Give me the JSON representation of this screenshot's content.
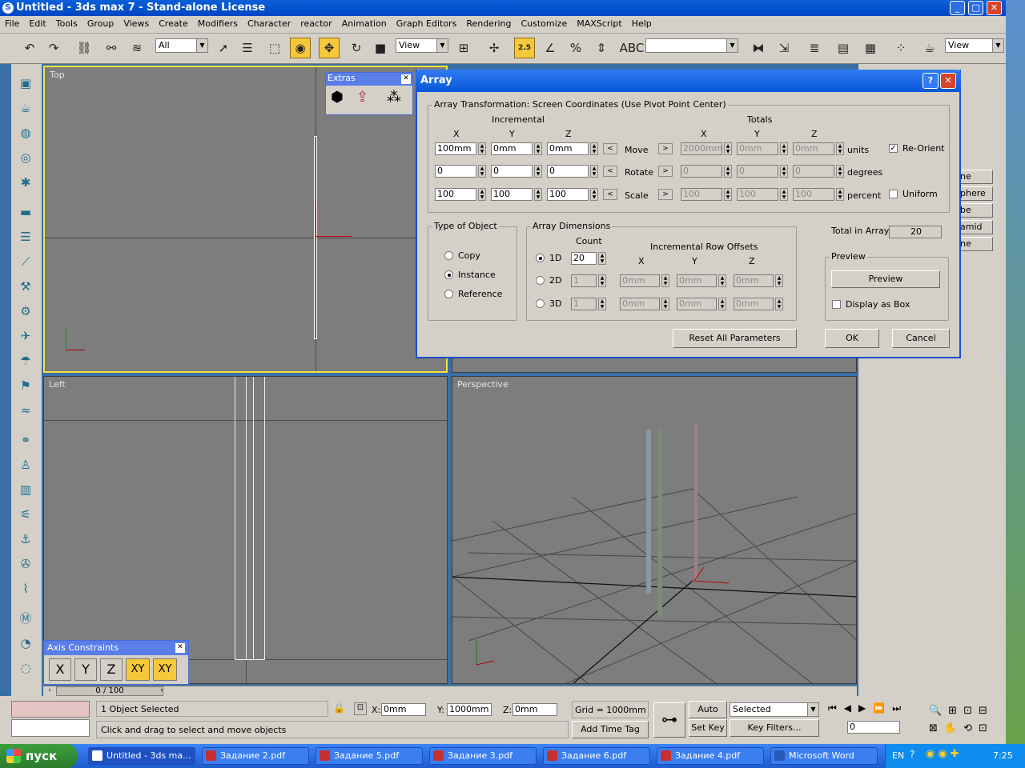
{
  "window": {
    "title": "Untitled - 3ds max 7  - Stand-alone License"
  },
  "menu": [
    "File",
    "Edit",
    "Tools",
    "Group",
    "Views",
    "Create",
    "Modifiers",
    "Character",
    "reactor",
    "Animation",
    "Graph Editors",
    "Rendering",
    "Customize",
    "MAXScript",
    "Help"
  ],
  "toolbar": {
    "filter": "All",
    "ref_coord": "View",
    "ref_coord2": "View",
    "snap_label": "2.5",
    "named_sel": ""
  },
  "viewports": {
    "top": "Top",
    "left": "Left",
    "perspective": "Perspective"
  },
  "extras": {
    "title": "Extras"
  },
  "axis": {
    "title": "Axis Constraints",
    "buttons": [
      "X",
      "Y",
      "Z",
      "XY",
      "XY"
    ]
  },
  "timeline": {
    "frame": "0 / 100"
  },
  "right_panel": {
    "items": [
      "ne",
      "phere",
      "be",
      "amid",
      "ne"
    ]
  },
  "array_dialog": {
    "title": "Array",
    "transform_group": "Array Transformation: Screen Coordinates (Use Pivot Point Center)",
    "incremental": "Incremental",
    "totals": "Totals",
    "x": "X",
    "y": "Y",
    "z": "Z",
    "rows": [
      {
        "label": "Move",
        "inc": [
          "100mm",
          "0mm",
          "0mm"
        ],
        "tot": [
          "2000mm",
          "0mm",
          "0mm"
        ],
        "unit": "units",
        "opt": "Re-Orient",
        "checked": true
      },
      {
        "label": "Rotate",
        "inc": [
          "0",
          "0",
          "0"
        ],
        "tot": [
          "0",
          "0",
          "0"
        ],
        "unit": "degrees",
        "opt": "",
        "checked": false
      },
      {
        "label": "Scale",
        "inc": [
          "100",
          "100",
          "100"
        ],
        "tot": [
          "100",
          "100",
          "100"
        ],
        "unit": "percent",
        "opt": "Uniform",
        "checked": false
      }
    ],
    "type_group": "Type of Object",
    "types": [
      "Copy",
      "Instance",
      "Reference"
    ],
    "selected_type": "Instance",
    "dims_group": "Array Dimensions",
    "count": "Count",
    "row_offsets": "Incremental Row Offsets",
    "dims": [
      {
        "label": "1D",
        "count": "20",
        "offsets": []
      },
      {
        "label": "2D",
        "count": "1",
        "offsets": [
          "0mm",
          "0mm",
          "0mm"
        ]
      },
      {
        "label": "3D",
        "count": "1",
        "offsets": [
          "0mm",
          "0mm",
          "0mm"
        ]
      }
    ],
    "total_label": "Total in Array:",
    "total": "20",
    "preview_group": "Preview",
    "preview_btn": "Preview",
    "display_as_box": "Display as Box",
    "reset": "Reset All Parameters",
    "ok": "OK",
    "cancel": "Cancel"
  },
  "status": {
    "selected": "1 Object Selected",
    "prompt": "Click and drag to select and move objects",
    "x_label": "X:",
    "x": "0mm",
    "y_label": "Y:",
    "y": "1000mm",
    "z_label": "Z:",
    "z": "0mm",
    "grid": "Grid = 1000mm",
    "add_time_tag": "Add Time Tag",
    "auto_key": "Auto Key",
    "set_key": "Set Key",
    "selected_dd": "Selected",
    "key_filters": "Key Filters...",
    "frame": "0"
  },
  "taskbar": {
    "start": "пуск",
    "tasks": [
      "Untitled - 3ds ma...",
      "Задание 2.pdf",
      "Задание 5.pdf",
      "Задание 3.pdf",
      "Задание 6.pdf",
      "Задание 4.pdf",
      "Microsoft Word"
    ],
    "lang": "EN",
    "time": "7:25"
  }
}
